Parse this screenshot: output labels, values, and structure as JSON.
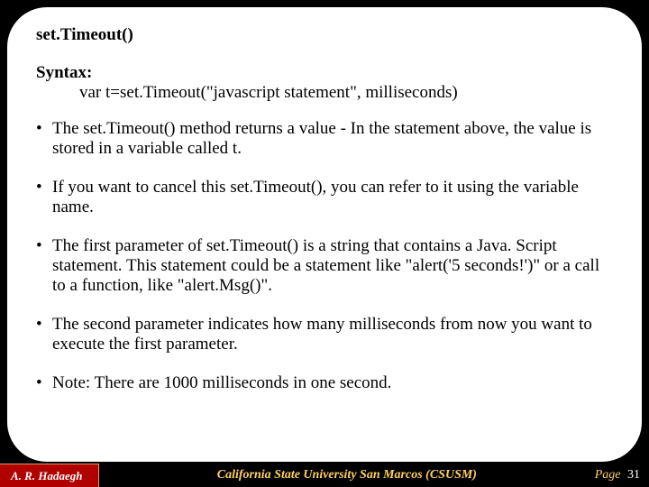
{
  "title": "set.Timeout()",
  "syntax": {
    "label": "Syntax:",
    "code": "var t=set.Timeout(\"javascript statement\", milliseconds)"
  },
  "bullets": [
    "The set.Timeout() method returns a value - In the statement above, the value is stored in a variable called t.",
    "If you want to cancel this set.Timeout(), you can refer to it using the variable name.",
    "The first parameter of set.Timeout() is a string that contains a Java. Script statement. This statement could be a statement like \"alert('5 seconds!')\" or a call to a function, like \"alert.Msg()\".",
    "The second parameter indicates how many milliseconds from now you want to execute the first parameter.",
    "Note: There are 1000 milliseconds in one second."
  ],
  "footer": {
    "author": "A. R. Hadaegh",
    "institution": "California State University San Marcos (CSUSM)",
    "page_label": "Page",
    "page_number": "31"
  }
}
